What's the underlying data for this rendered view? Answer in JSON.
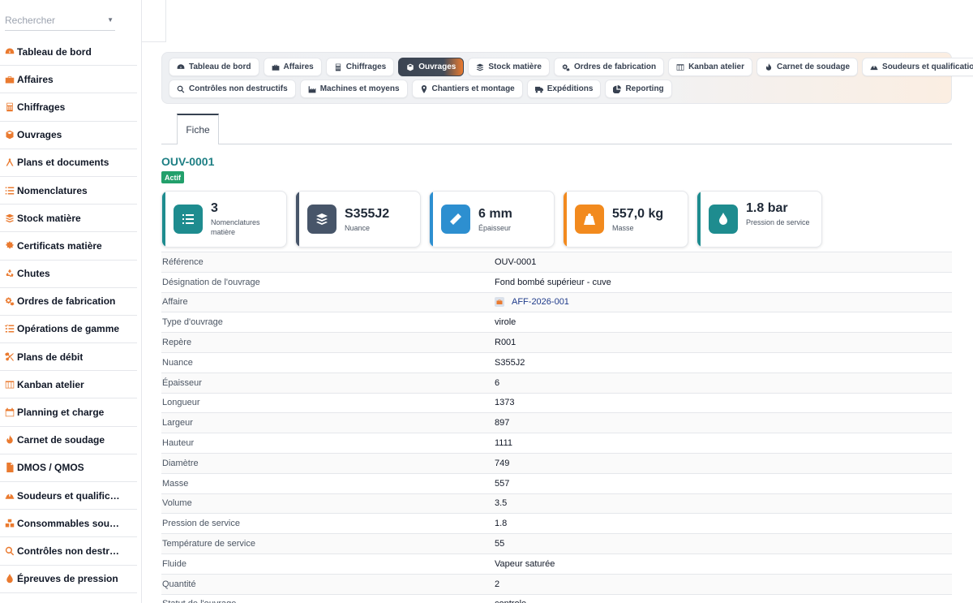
{
  "search": {
    "placeholder": "Rechercher"
  },
  "sidebar": {
    "items": [
      {
        "label": "Tableau de bord",
        "icon": "gauge-icon"
      },
      {
        "label": "Affaires",
        "icon": "briefcase-icon"
      },
      {
        "label": "Chiffrages",
        "icon": "calculator-icon"
      },
      {
        "label": "Ouvrages",
        "icon": "cube-icon"
      },
      {
        "label": "Plans et documents",
        "icon": "compass-drafting-icon"
      },
      {
        "label": "Nomenclatures",
        "icon": "list-icon"
      },
      {
        "label": "Stock matière",
        "icon": "layers-icon"
      },
      {
        "label": "Certificats matière",
        "icon": "certificate-icon"
      },
      {
        "label": "Chutes",
        "icon": "recycle-icon"
      },
      {
        "label": "Ordres de fabrication",
        "icon": "gears-icon"
      },
      {
        "label": "Opérations de gamme",
        "icon": "list-check-icon"
      },
      {
        "label": "Plans de débit",
        "icon": "scissors-icon"
      },
      {
        "label": "Kanban atelier",
        "icon": "columns-icon"
      },
      {
        "label": "Planning et charge",
        "icon": "calendar-icon"
      },
      {
        "label": "Carnet de soudage",
        "icon": "fire-icon"
      },
      {
        "label": "DMOS / QMOS",
        "icon": "file-icon"
      },
      {
        "label": "Soudeurs et qualific…",
        "icon": "helmet-icon"
      },
      {
        "label": "Consommables sou…",
        "icon": "boxes-icon"
      },
      {
        "label": "Contrôles non destr…",
        "icon": "search-icon"
      },
      {
        "label": "Épreuves de pression",
        "icon": "droplet-icon"
      }
    ]
  },
  "modules": {
    "row1": [
      {
        "label": "Tableau de bord",
        "icon": "gauge-icon"
      },
      {
        "label": "Affaires",
        "icon": "briefcase-icon"
      },
      {
        "label": "Chiffrages",
        "icon": "calculator-icon"
      },
      {
        "label": "Ouvrages",
        "icon": "cube-icon",
        "active": true
      },
      {
        "label": "Stock matière",
        "icon": "layers-icon"
      },
      {
        "label": "Ordres de fabrication",
        "icon": "gears-icon"
      },
      {
        "label": "Kanban atelier",
        "icon": "columns-icon"
      },
      {
        "label": "Carnet de soudage",
        "icon": "fire-icon"
      },
      {
        "label": "Soudeurs et qualifications",
        "icon": "helmet-icon"
      }
    ],
    "row2": [
      {
        "label": "Contrôles non destructifs",
        "icon": "search-icon"
      },
      {
        "label": "Machines et moyens",
        "icon": "industry-icon"
      },
      {
        "label": "Chantiers et montage",
        "icon": "location-pin-icon"
      },
      {
        "label": "Expéditions",
        "icon": "truck-icon"
      },
      {
        "label": "Reporting",
        "icon": "pie-chart-icon"
      }
    ]
  },
  "tabs": {
    "fiche": "Fiche"
  },
  "record": {
    "code": "OUV-0001",
    "status": "Actif"
  },
  "cards": [
    {
      "value": "3",
      "label": "Nomenclatures matière",
      "icon": "list-icon",
      "color": "#1e8c8f"
    },
    {
      "value": "S355J2",
      "label": "Nuance",
      "icon": "layers-icon",
      "color": "#475569"
    },
    {
      "value": "6 mm",
      "label": "Épaisseur",
      "icon": "ruler-icon",
      "color": "#2d8fd0"
    },
    {
      "value": "557,0 kg",
      "label": "Masse",
      "icon": "weight-icon",
      "color": "#f28a1e"
    },
    {
      "value": "1.8 bar",
      "label": "Pression de service",
      "icon": "droplet-icon",
      "color": "#1e8c8f"
    }
  ],
  "details": [
    {
      "key": "Référence",
      "value": "OUV-0001"
    },
    {
      "key": "Désignation de l'ouvrage",
      "value": "Fond bombé supérieur - cuve"
    },
    {
      "key": "Affaire",
      "value": "AFF-2026-001",
      "link": true
    },
    {
      "key": "Type d'ouvrage",
      "value": "virole"
    },
    {
      "key": "Repère",
      "value": "R001"
    },
    {
      "key": "Nuance",
      "value": "S355J2"
    },
    {
      "key": "Épaisseur",
      "value": "6"
    },
    {
      "key": "Longueur",
      "value": "1373"
    },
    {
      "key": "Largeur",
      "value": "897"
    },
    {
      "key": "Hauteur",
      "value": "1111"
    },
    {
      "key": "Diamètre",
      "value": "749"
    },
    {
      "key": "Masse",
      "value": "557"
    },
    {
      "key": "Volume",
      "value": "3.5"
    },
    {
      "key": "Pression de service",
      "value": "1.8"
    },
    {
      "key": "Température de service",
      "value": "55"
    },
    {
      "key": "Fluide",
      "value": "Vapeur saturée"
    },
    {
      "key": "Quantité",
      "value": "2"
    },
    {
      "key": "Statut de l'ouvrage",
      "value": "controle"
    }
  ],
  "colors": {
    "accent": "#ea7a2f",
    "teal": "#1e7f84",
    "badge": "#22a06b",
    "dark": "#3b4452"
  }
}
